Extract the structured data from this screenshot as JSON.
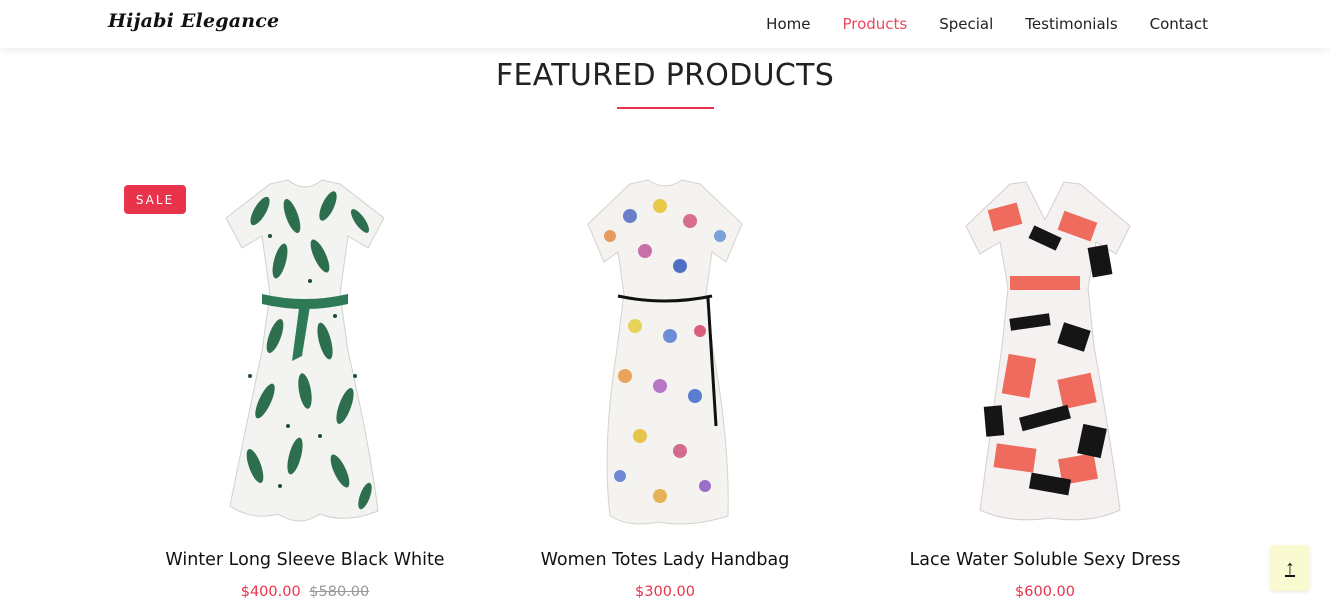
{
  "header": {
    "brand": "Hijabi Elegance",
    "nav": [
      "Home",
      "Products",
      "Special",
      "Testimonials",
      "Contact"
    ],
    "active_nav": "Products"
  },
  "section": {
    "title": "FEATURED PRODUCTS",
    "accent_color": "#e8334a"
  },
  "products": [
    {
      "name": "Winter Long Sleeve Black White",
      "badge": "SALE",
      "price": "$400.00",
      "old_price": "$580.00",
      "pattern": "green-leaf-print"
    },
    {
      "name": "Women Totes Lady Handbag",
      "price": "$300.00",
      "pattern": "floral-print"
    },
    {
      "name": "Lace Water Soluble Sexy Dress",
      "price": "$600.00",
      "pattern": "red-black-abstract-print"
    }
  ],
  "back_to_top": {
    "label": "↑"
  }
}
